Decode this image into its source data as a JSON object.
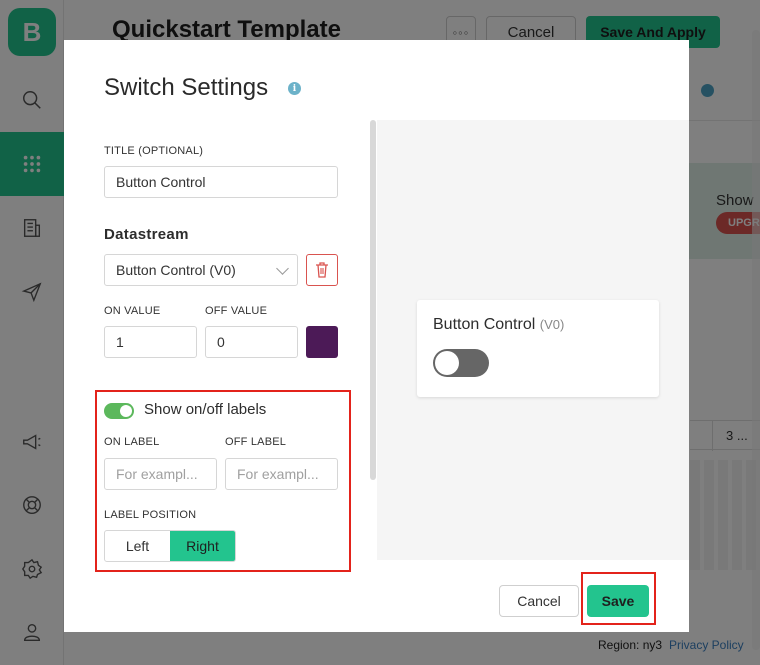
{
  "app": {
    "logo_letter": "B",
    "page_title": "Quickstart Template",
    "top_cancel": "Cancel",
    "top_save": "Save And Apply",
    "more_dots": "◦◦◦",
    "bg_show": "Show",
    "bg_upgrade": "UPGR",
    "bg_col_num": "3 ...",
    "region": "Region: ny3",
    "privacy": "Privacy Policy",
    "sidebar_icons": [
      "search-icon",
      "grid-icon",
      "building-icon",
      "send-icon",
      "megaphone-icon",
      "lifebuoy-icon",
      "gear-icon",
      "user-icon"
    ],
    "accent_color": "#23c48e"
  },
  "modal": {
    "title": "Switch Settings",
    "info": "i",
    "title_label": "TITLE (OPTIONAL)",
    "title_value": "Button Control",
    "datastream_heading": "Datastream",
    "datastream_value": "Button Control (V0)",
    "on_value_label": "ON VALUE",
    "off_value_label": "OFF VALUE",
    "on_value": "1",
    "off_value": "0",
    "color": "#4c1a57",
    "show_labels_text": "Show on/off labels",
    "show_labels_enabled": true,
    "on_label_label": "ON LABEL",
    "off_label_label": "OFF LABEL",
    "on_label_placeholder": "For exampl...",
    "off_label_placeholder": "For exampl...",
    "label_position_label": "LABEL POSITION",
    "position_left": "Left",
    "position_right": "Right",
    "position_selected": "Right",
    "preview_title": "Button Control",
    "preview_pin": "(V0)",
    "preview_state": "off",
    "cancel": "Cancel",
    "save": "Save"
  }
}
